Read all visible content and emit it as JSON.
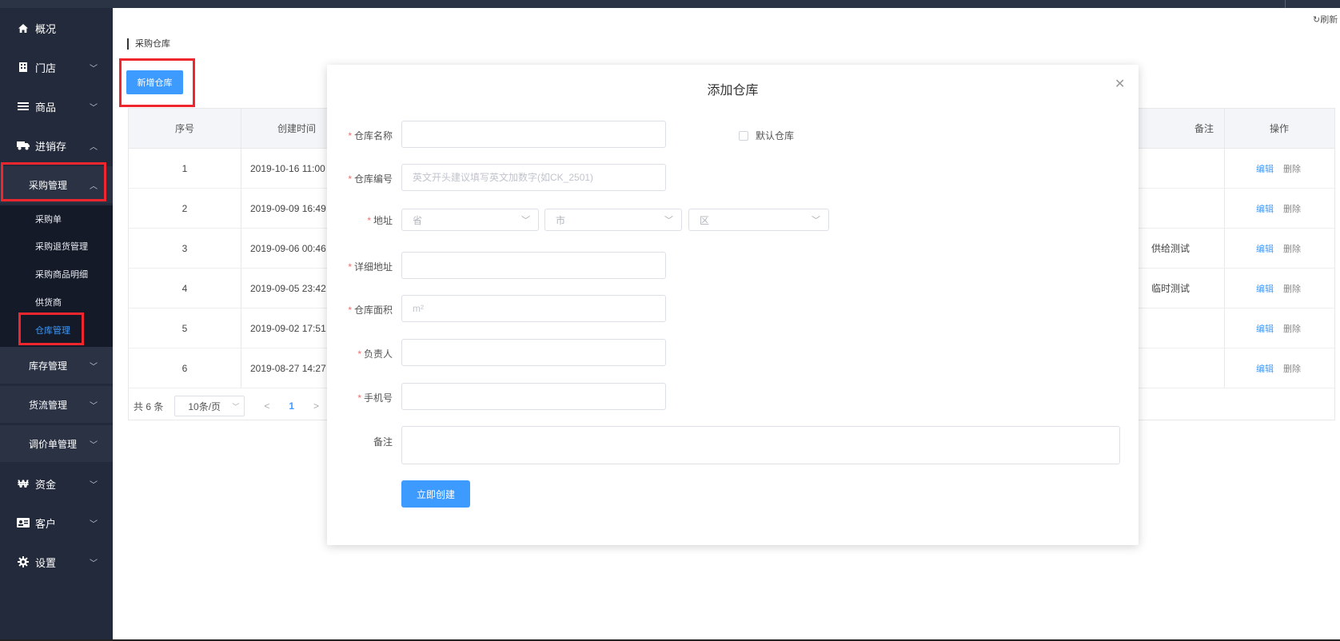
{
  "header": {
    "refresh_label": "刷新"
  },
  "sidebar": {
    "items": [
      {
        "label": "概况",
        "icon": "home-icon"
      },
      {
        "label": "门店",
        "icon": "store-icon"
      },
      {
        "label": "商品",
        "icon": "list-icon"
      },
      {
        "label": "进销存",
        "icon": "truck-icon"
      }
    ],
    "purchase_group": {
      "label": "采购管理",
      "children": [
        "采购单",
        "采购退货管理",
        "采购商品明细",
        "供货商",
        "仓库管理"
      ],
      "active": "仓库管理"
    },
    "sub_groups": [
      "库存管理",
      "货流管理",
      "调价单管理"
    ],
    "bottom_items": [
      {
        "label": "资金",
        "icon": "won-icon"
      },
      {
        "label": "客户",
        "icon": "id-card-icon"
      },
      {
        "label": "设置",
        "icon": "gear-icon"
      }
    ]
  },
  "page": {
    "breadcrumb": "采购仓库",
    "add_button": "新增仓库"
  },
  "table": {
    "columns": [
      "序号",
      "创建时间",
      "备注",
      "操作"
    ],
    "rows": [
      {
        "no": "1",
        "created": "2019-10-16 11:00",
        "remark": ""
      },
      {
        "no": "2",
        "created": "2019-09-09 16:49",
        "remark": ""
      },
      {
        "no": "3",
        "created": "2019-09-06 00:46",
        "remark": "供给测试"
      },
      {
        "no": "4",
        "created": "2019-09-05 23:42",
        "remark": "临时测试"
      },
      {
        "no": "5",
        "created": "2019-09-02 17:51",
        "remark": ""
      },
      {
        "no": "6",
        "created": "2019-08-27 14:27",
        "remark": ""
      }
    ],
    "edit_label": "编辑",
    "delete_label": "删除"
  },
  "pagination": {
    "total": "共 6 条",
    "page_size": "10条/页",
    "current_page": "1"
  },
  "modal": {
    "title": "添加仓库",
    "fields": {
      "name_label": "仓库名称",
      "default_label": "默认仓库",
      "code_label": "仓库编号",
      "code_placeholder": "英文开头建议填写英文加数字(如CK_2501)",
      "address_label": "地址",
      "province_placeholder": "省",
      "city_placeholder": "市",
      "district_placeholder": "区",
      "detail_label": "详细地址",
      "area_label": "仓库面积",
      "area_placeholder": "m²",
      "owner_label": "负责人",
      "phone_label": "手机号",
      "remark_label": "备注"
    },
    "submit_label": "立即创建"
  },
  "colors": {
    "accent": "#3d9bff",
    "sidebar": "#232a3b",
    "highlight": "#f0262e"
  }
}
